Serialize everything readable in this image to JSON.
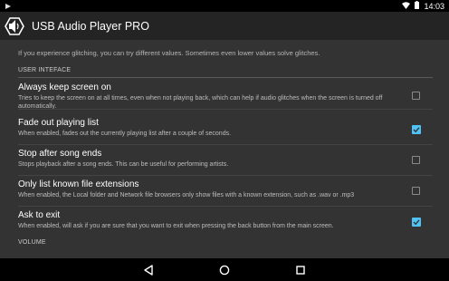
{
  "status_bar": {
    "notification_icon": "play-icon",
    "wifi_icon": "wifi-icon",
    "battery_icon": "battery-icon",
    "time": "14:03"
  },
  "app_bar": {
    "logo_icon": "usb-audio-logo",
    "title": "USB Audio Player PRO"
  },
  "content": {
    "partial_text": "If you experience glitching, you can try different values. Sometimes even lower values solve glitches.",
    "section_header": "USER INTEFACE",
    "next_section_header": "VOLUME",
    "preferences": [
      {
        "title": "Always keep screen on",
        "summary": "Tries to keep the screen on at all times, even when not playing back, which can help if audio glitches when the screen is turned off automatically.",
        "checked": false
      },
      {
        "title": "Fade out playing list",
        "summary": "When enabled, fades out the currently playing list after a couple of seconds.",
        "checked": true
      },
      {
        "title": "Stop after song ends",
        "summary": "Stops playback after a song ends. This can be useful for performing artists.",
        "checked": false
      },
      {
        "title": "Only list known file extensions",
        "summary": "When enabled, the Local folder and Network file browsers only show files with a known extension, such as .wav or .mp3",
        "checked": false
      },
      {
        "title": "Ask to exit",
        "summary": "When enabled, will ask if you are sure that you want to exit when pressing the back button from the main screen.",
        "checked": true
      }
    ]
  },
  "nav_bar": {
    "back_icon": "back-icon",
    "home_icon": "home-icon",
    "recents_icon": "recents-icon"
  },
  "colors": {
    "accent": "#4fc3f7",
    "background": "#333333",
    "app_bar": "#242424"
  }
}
